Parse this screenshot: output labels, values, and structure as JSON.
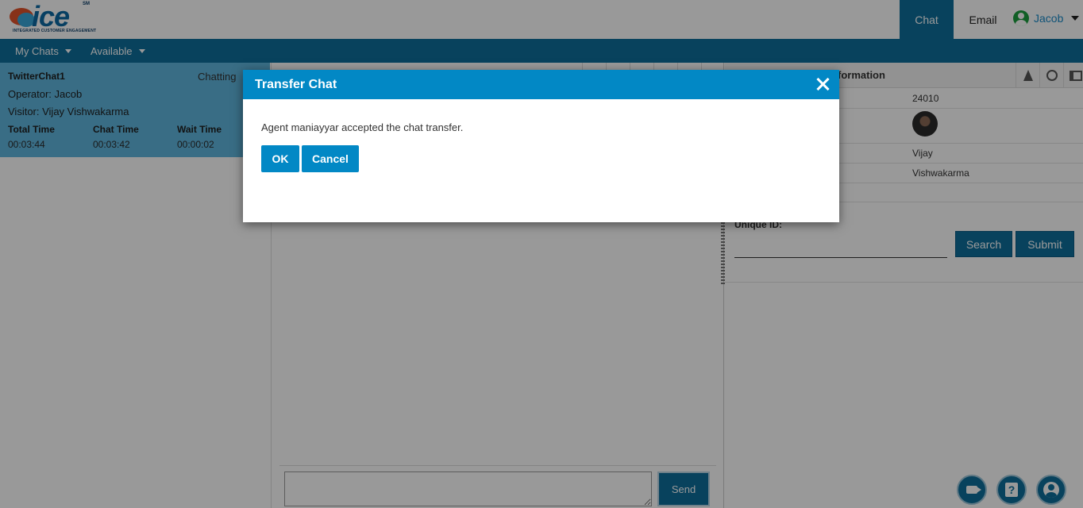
{
  "header": {
    "logo_sub": "INTEGRATED CUSTOMER ENGAGEMENT",
    "logo_sm": "SM",
    "tabs": [
      "Chat",
      "Email"
    ],
    "user_name": "Jacob"
  },
  "nav": {
    "items": [
      "My Chats",
      "Available"
    ]
  },
  "chat_card": {
    "name": "TwitterChat1",
    "status": "Chatting",
    "operator": "Operator: Jacob",
    "visitor": "Visitor: Vijay Vishwakarma",
    "columns": [
      {
        "label": "Total Time",
        "value": "00:03:44"
      },
      {
        "label": "Chat Time",
        "value": "00:03:42"
      },
      {
        "label": "Wait Time",
        "value": "00:00:02"
      }
    ]
  },
  "composer": {
    "send_label": "Send"
  },
  "info_panel": {
    "title_fragment": "formation",
    "id_value": "24010",
    "first_name": "Vijay",
    "last_name": "Vishwakarma",
    "unique_id_label": "Unique ID:",
    "search_label": "Search",
    "submit_label": "Submit"
  },
  "modal": {
    "title": "Transfer Chat",
    "message": "Agent maniayyar accepted the chat transfer.",
    "ok_label": "OK",
    "cancel_label": "Cancel"
  },
  "colors": {
    "primary": "#0e6f9c",
    "modal_header": "#0288c5",
    "chat_card_bg": "#5fb6de"
  }
}
